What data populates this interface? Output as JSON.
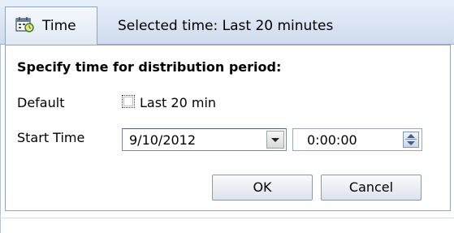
{
  "toolbar": {
    "time_button_label": "Time",
    "selected_time": "Selected time: Last 20 minutes",
    "time_icon": "clock-calendar-icon"
  },
  "panel": {
    "heading": "Specify time for distribution period:",
    "default_label": "Default",
    "default_checkbox_label": "Last 20 min",
    "default_checked": false,
    "start_time_label": "Start Time",
    "start_date_value": "9/10/2012",
    "start_time_value": "0:00:00",
    "ok_label": "OK",
    "cancel_label": "Cancel"
  }
}
